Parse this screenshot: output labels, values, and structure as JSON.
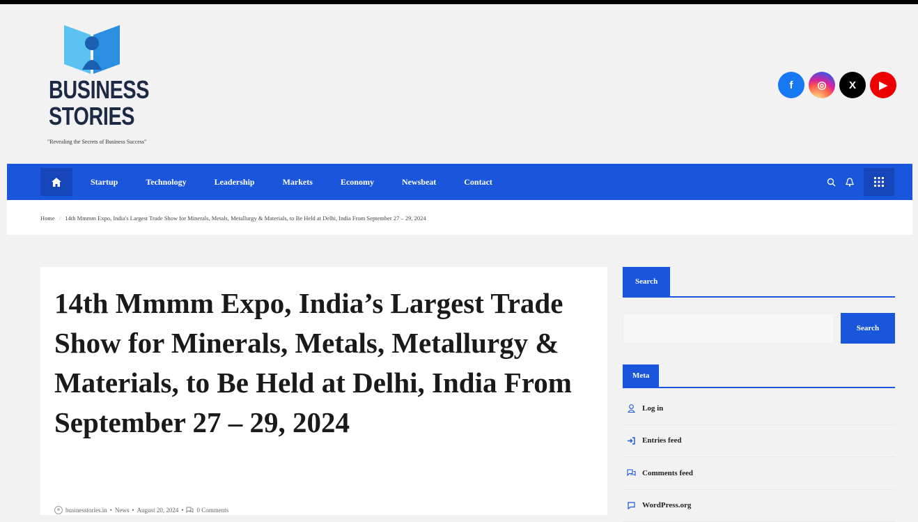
{
  "site": {
    "logo_line1": "BUSINESS",
    "logo_line2": "STORIES",
    "tagline": "\"Revealing the Secrets of Business Success\""
  },
  "social": [
    {
      "name": "facebook-icon",
      "glyph": "f"
    },
    {
      "name": "instagram-icon",
      "glyph": "◎"
    },
    {
      "name": "x-icon",
      "glyph": "X"
    },
    {
      "name": "youtube-icon",
      "glyph": "▶"
    }
  ],
  "nav": {
    "items": [
      "Startup",
      "Technology",
      "Leadership",
      "Markets",
      "Economy",
      "Newsbeat",
      "Contact"
    ]
  },
  "breadcrumb": {
    "home": "Home",
    "current": "14th Mmmm Expo, India's Largest Trade Show for Minerals, Metals, Metallurgy & Materials, to Be Held at Delhi, India From September 27 – 29, 2024"
  },
  "article": {
    "title": "14th Mmmm Expo, India’s Largest Trade Show for Minerals, Metals, Metallurgy & Materials, to Be Held at Delhi, India From September 27 – 29, 2024",
    "author": "businesstories.in",
    "category": "News",
    "date": "August 20, 2024",
    "comments": "0 Comments"
  },
  "sidebar": {
    "search_title": "Search",
    "search_button": "Search",
    "search_placeholder": "",
    "meta_title": "Meta",
    "meta_items": [
      "Log in",
      "Entries feed",
      "Comments feed",
      "WordPress.org"
    ]
  },
  "colors": {
    "accent": "#1a56db",
    "accent_dark": "#1545b8"
  }
}
